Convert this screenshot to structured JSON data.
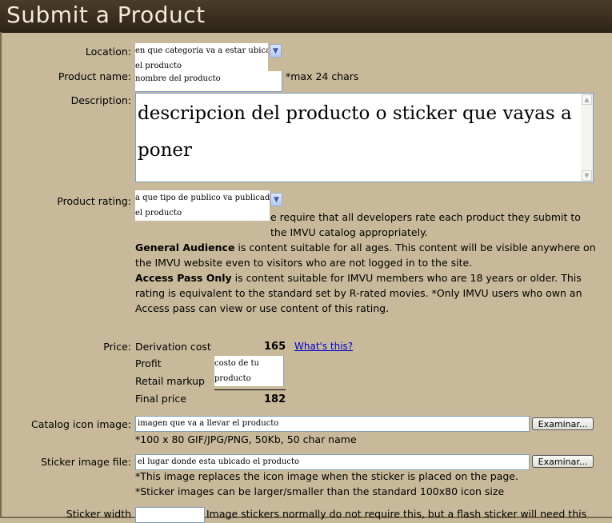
{
  "title": "Submit a Product",
  "location": {
    "label": "Location:",
    "value_line1": "en que categoria va a estar ubicado",
    "value_line2": "el producto"
  },
  "product_name": {
    "label": "Product name:",
    "value": "nombre del producto",
    "hint": "*max 24 chars"
  },
  "description": {
    "label": "Description:",
    "value": "descripcion del producto o sticker que vayas a poner"
  },
  "rating": {
    "label": "Product rating:",
    "value_line1": "a que tipo de publico va publicado",
    "value_line2": "el producto",
    "intro_visible": "e require that all developers rate each product they submit to the IMVU catalog appropriately.",
    "general_heading": "General Audience",
    "general_text": " is content suitable for all ages. This content will be visible anywhere on the IMVU website even to visitors who are not logged in to the site.",
    "access_heading": "Access Pass Only",
    "access_text": " is content suitable for IMVU members who are 18 years or older. This rating is equivalent to the standard set by R-rated movies. *Only IMVU users who own an Access pass can view or use content of this rating."
  },
  "price": {
    "label": "Price:",
    "derivation_label": "Derivation cost",
    "derivation_value": "165",
    "whats_this": "What's this?",
    "profit_label": "Profit",
    "profit_line1": "costo de tu",
    "profit_line2": "producto",
    "retail_label": "Retail markup",
    "final_label": "Final price",
    "final_value": "182"
  },
  "catalog_icon": {
    "label": "Catalog icon image:",
    "value": "imagen que va a llevar el producto",
    "browse_label": "Examinar...",
    "hint": "*100 x 80 GIF/JPG/PNG, 50Kb, 50 char name"
  },
  "sticker_image": {
    "label": "Sticker image file:",
    "value": "el lugar donde esta ubicado el producto",
    "browse_label": "Examinar...",
    "hint1": "*This image replaces the icon image when the sticker is placed on the page.",
    "hint2": "*Sticker images can be larger/smaller than the standard 100x80 icon size"
  },
  "sticker_width": {
    "label": "Sticker width",
    "hint": "Image stickers normally do not require this, but a flash sticker will need this"
  },
  "colors": {
    "background": "#c8b99a",
    "titlebar": "#2e2416",
    "link": "#0000cc"
  }
}
